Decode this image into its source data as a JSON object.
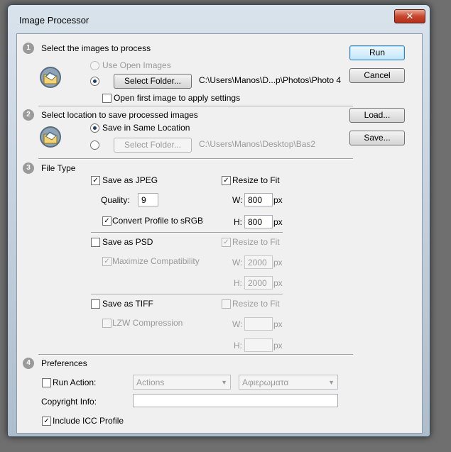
{
  "window": {
    "title": "Image Processor",
    "close_glyph": "✕"
  },
  "buttons": {
    "run": "Run",
    "cancel": "Cancel",
    "load": "Load...",
    "save": "Save..."
  },
  "section1": {
    "number": "1",
    "heading": "Select the images to process",
    "use_open_images": "Use Open Images",
    "select_folder": "Select Folder...",
    "folder_path": "C:\\Users\\Manos\\D...p\\Photos\\Photo 4",
    "open_first_image": "Open first image to apply settings"
  },
  "section2": {
    "number": "2",
    "heading": "Select location to save processed images",
    "save_same_location": "Save in Same Location",
    "select_folder": "Select Folder...",
    "folder_path": "C:\\Users\\Manos\\Desktop\\Bas2"
  },
  "section3": {
    "number": "3",
    "heading": "File Type",
    "jpeg": {
      "label": "Save as JPEG",
      "checked": true,
      "quality_label": "Quality:",
      "quality": "9",
      "convert_srgb": "Convert Profile to sRGB",
      "resize": "Resize to Fit",
      "w_label": "W:",
      "w": "800",
      "h_label": "H:",
      "h": "800",
      "unit": "px"
    },
    "psd": {
      "label": "Save as PSD",
      "maximize": "Maximize Compatibility",
      "resize": "Resize to Fit",
      "w_label": "W:",
      "w": "2000",
      "h_label": "H:",
      "h": "2000",
      "unit": "px"
    },
    "tiff": {
      "label": "Save as TIFF",
      "lzw": "LZW Compression",
      "resize": "Resize to Fit",
      "w_label": "W:",
      "w": "",
      "h_label": "H:",
      "h": "",
      "unit": "px"
    }
  },
  "section4": {
    "number": "4",
    "heading": "Preferences",
    "run_action": "Run Action:",
    "action_set": "Actions",
    "action": "Αφιερωματα",
    "copyright_label": "Copyright Info:",
    "copyright_value": "",
    "include_icc": "Include ICC Profile"
  },
  "glyphs": {
    "check": "✓",
    "dropdown": "▼"
  }
}
